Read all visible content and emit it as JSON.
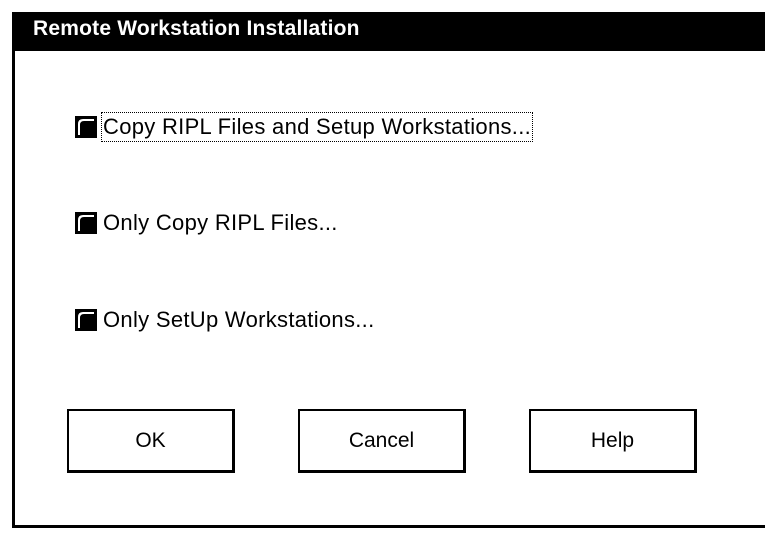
{
  "dialog": {
    "title": "Remote Workstation Installation",
    "options": [
      {
        "label": "Copy RIPL Files and Setup Workstations...",
        "icon": "push-button-icon",
        "focused": true
      },
      {
        "label": "Only Copy RIPL Files...",
        "icon": "push-button-icon",
        "focused": false
      },
      {
        "label": "Only SetUp Workstations...",
        "icon": "push-button-icon",
        "focused": false
      }
    ],
    "buttons": {
      "ok": "OK",
      "cancel": "Cancel",
      "help": "Help"
    }
  }
}
